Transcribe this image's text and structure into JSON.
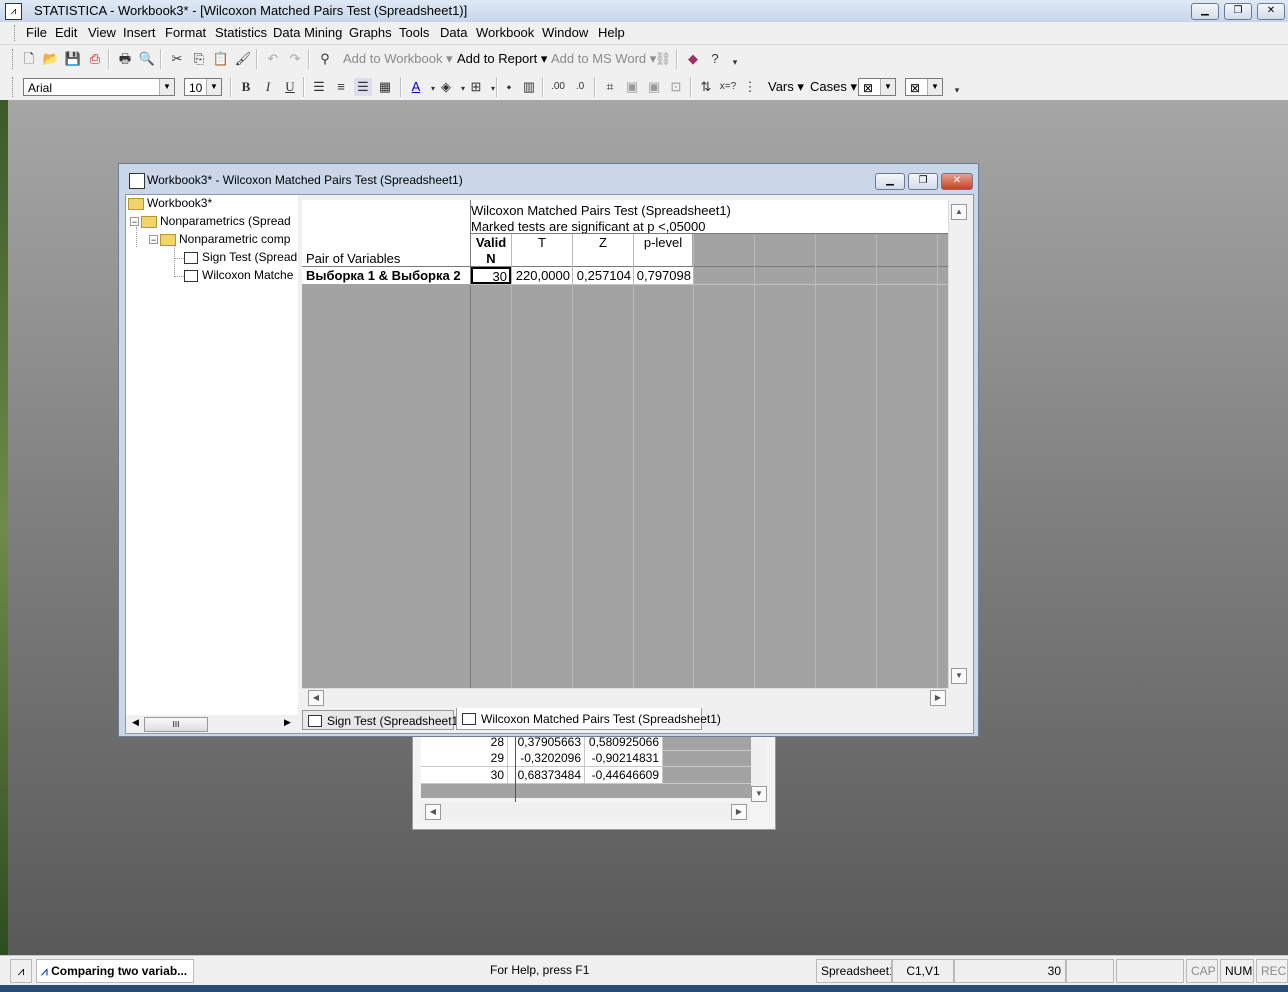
{
  "app": {
    "title": "STATISTICA - Workbook3* - [Wilcoxon Matched Pairs Test (Spreadsheet1)]",
    "icon": "statistica-icon"
  },
  "menu": [
    "File",
    "Edit",
    "View",
    "Insert",
    "Format",
    "Statistics",
    "Data Mining",
    "Graphs",
    "Tools",
    "Data",
    "Workbook",
    "Window",
    "Help"
  ],
  "toolbar1": {
    "add_to_workbook": "Add to Workbook",
    "add_to_report": "Add to Report",
    "add_to_ms_word": "Add to MS Word"
  },
  "toolbar2": {
    "font": "Arial",
    "size": "10",
    "bold": "B",
    "italic": "I",
    "underline": "U",
    "vars": "Vars",
    "cases": "Cases"
  },
  "bg_sheet": {
    "rows": [
      {
        "n": "28",
        "a": "0,37905663",
        "b": "0,580925066"
      },
      {
        "n": "29",
        "a": "-0,3202096",
        "b": "-0,90214831"
      },
      {
        "n": "30",
        "a": "0,68373484",
        "b": "-0,44646609"
      }
    ]
  },
  "workbook_window": {
    "title": "Workbook3* - Wilcoxon Matched Pairs Test (Spreadsheet1)",
    "tree": {
      "root": "Workbook3*",
      "node1": "Nonparametrics (Spread",
      "node2": "Nonparametric comp",
      "leaf1": "Sign Test (Spread",
      "leaf2": "Wilcoxon Matche"
    },
    "sheet": {
      "title_line1": "Wilcoxon Matched Pairs Test (Spreadsheet1)",
      "title_line2": "Marked tests are significant at p <,05000",
      "row_header_label": "Pair of Variables",
      "columns": [
        "Valid\nN",
        "T",
        "Z",
        "p-level"
      ],
      "row": {
        "label": "Выборка 1 & Выборка 2",
        "values": [
          "30",
          "220,0000",
          "0,257104",
          "0,797098"
        ]
      }
    },
    "tabs": [
      "Sign Test (Spreadsheet1)",
      "Wilcoxon Matched Pairs Test (Spreadsheet1)"
    ]
  },
  "statusbar": {
    "task": "Comparing two variab...",
    "help": "For Help, press F1",
    "sheet": "Spreadsheet1",
    "cell": "C1,V1",
    "value": "30",
    "cap": "CAP",
    "num": "NUM",
    "rec": "REC"
  }
}
